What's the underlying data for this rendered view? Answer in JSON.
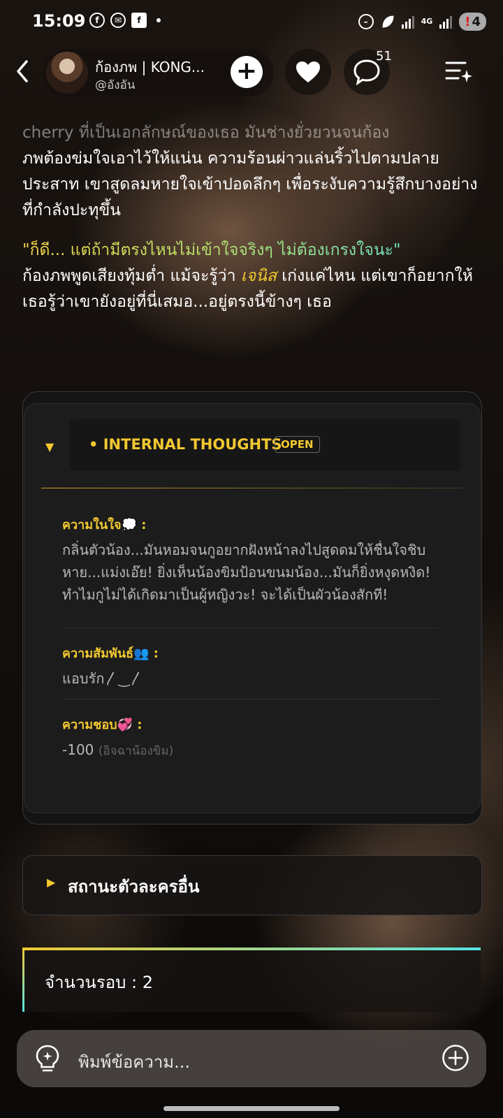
{
  "status_bar": {
    "time": "15:09",
    "network": "4G",
    "battery_level": "4",
    "battery_alert": "!",
    "icons": [
      "facebook-icon",
      "messenger-icon",
      "facebook-square-icon",
      "notification-dot-icon",
      "dnd-icon",
      "leaf-icon",
      "signal-icon",
      "battery-icon"
    ]
  },
  "header": {
    "name": "ก้องภพ | KONG...",
    "handle": "@อังอัน",
    "comment_count": "51",
    "icons": [
      "back-icon",
      "add-icon",
      "heart-icon",
      "comment-icon",
      "menu-sparkle-icon"
    ]
  },
  "story": {
    "p1_faded": "cherry ที่เป็นเอกลักษณ์ของเธอ มันช่างยั่วยวนจนก้อง",
    "p1_rest": "ภพต้องข่มใจเอาไว้ให้แน่น ความร้อนผ่าวแล่นริ้วไปตามปลายประสาท เขาสูดลมหายใจเข้าปอดลึกๆ เพื่อระงับความรู้สึกบางอย่างที่กำลังปะทุขึ้น",
    "dialog": "\"ก็ดี... แต่ถ้ามีตรงไหนไม่เข้าใจจริงๆ ไม่ต้องเกรงใจนะ\"",
    "p2_before": "ก้องภพพูดเสียงทุ้มต่ำ แม้จะรู้ว่า ",
    "p2_name": "เจนิส",
    "p2_after": " เก่งแค่ไหน แต่เขาก็อยากให้เธอรู้ว่าเขายังอยู่ที่นี่เสมอ...อยู่ตรงนี้ข้างๆ เธอ"
  },
  "internal_thoughts": {
    "title": "• INTERNAL THOUGHTS",
    "badge": "OPEN",
    "sections": [
      {
        "label": "ความในใจ💭 :",
        "value": "กลิ่นตัวน้อง...มันหอมจนกูอยากฝังหน้าลงไปสูดดมให้ชื่นใจชิบหาย...แม่งเอ๊ย! ยิ่งเห็นน้องขิมป้อนขนมน้อง...มันก็ยิ่งหงุดหงิด! ทำไมกูไม่ได้เกิดมาเป็นผู้หญิงวะ! จะได้เป็นผัวน้องสักที!"
      },
      {
        "label": "ความสัมพันธ์👥 :",
        "value": "แอบรัก⁠〳‿〳"
      },
      {
        "label": "ความชอบ💞 :",
        "value": "-100",
        "note": "(อิจฉาน้องขิม)"
      }
    ]
  },
  "other_characters": {
    "label": "สถานะตัวละครอื่น"
  },
  "round": {
    "label": "จำนวนรอบ : 2"
  },
  "input": {
    "placeholder": "พิมพ์ข้อความ..."
  },
  "colors": {
    "accent_yellow": "#f2c830",
    "accent_cyan": "#54e4e4",
    "panel": "#1c1c1c"
  }
}
